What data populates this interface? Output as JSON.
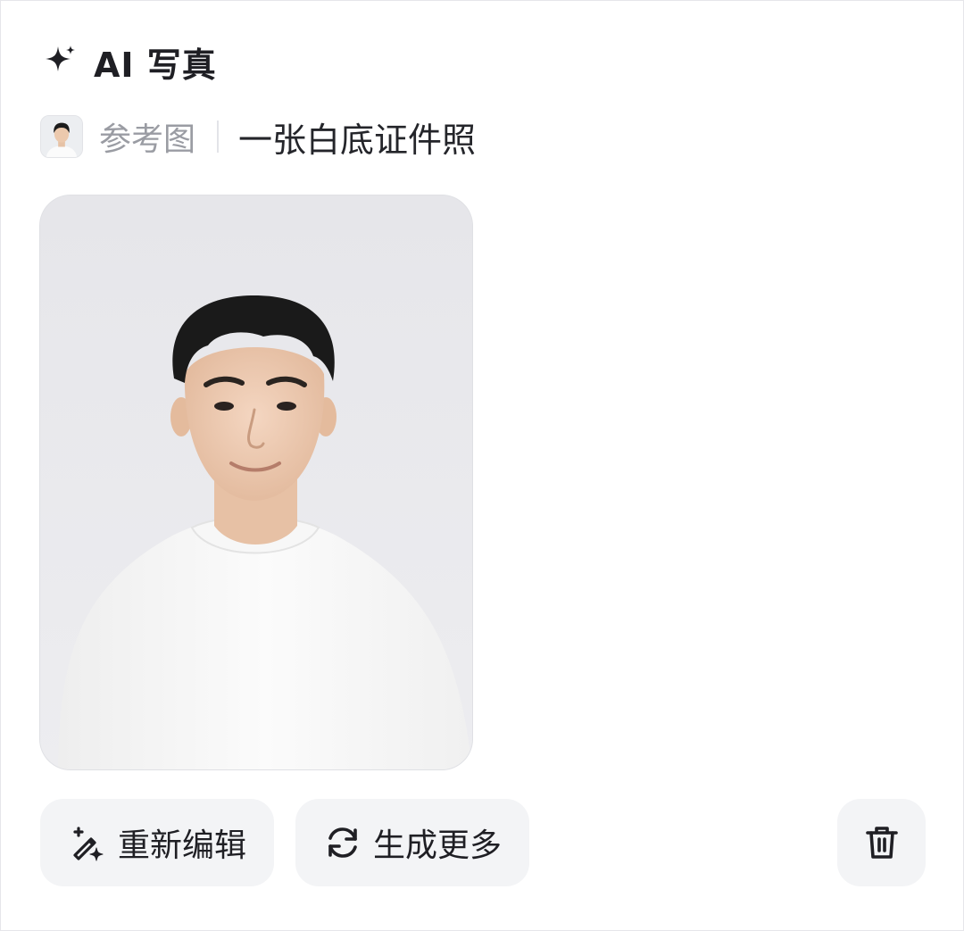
{
  "header": {
    "icon": "sparkle-icon",
    "title": "AI 写真"
  },
  "prompt": {
    "reference_label": "参考图",
    "text": "一张白底证件照"
  },
  "result": {
    "image": "generated-portrait"
  },
  "actions": {
    "re_edit_label": "重新编辑",
    "re_edit_icon": "magic-wand-icon",
    "generate_more_label": "生成更多",
    "generate_more_icon": "refresh-icon",
    "delete_icon": "trash-icon"
  },
  "colors": {
    "text_primary": "#1f1f24",
    "text_secondary": "#9a9ca3",
    "button_bg": "#f3f4f6",
    "divider": "#e3e4e8"
  }
}
